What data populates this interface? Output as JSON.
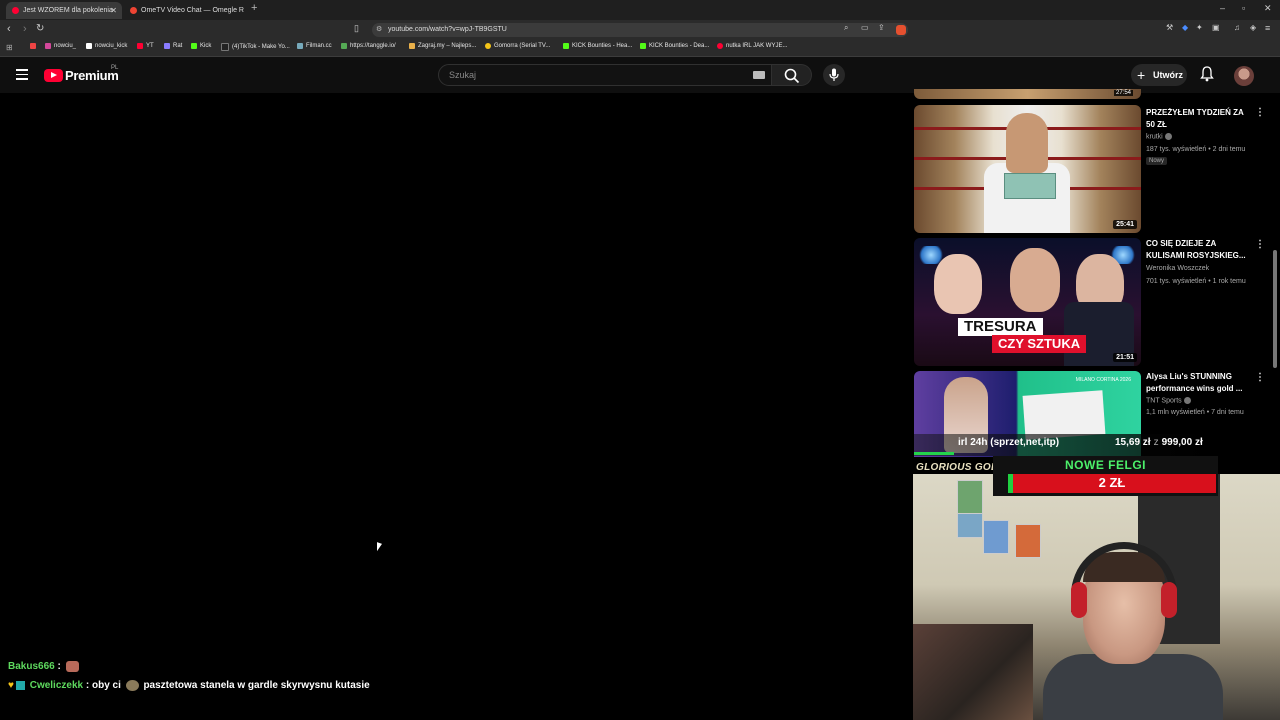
{
  "browser": {
    "tabs": [
      {
        "title": "Jest WZOREM dla pokolenia",
        "active": true
      },
      {
        "title": "OmeTV Video Chat — Omegle R",
        "active": false
      }
    ],
    "new_tab": "+",
    "window_controls": [
      "–",
      "▫",
      "✕"
    ],
    "url": "youtube.com/watch?v=wpJ-TB9GSTU",
    "bookmarks": [
      "nowciu_",
      "nowciu_kick",
      "YT",
      "Rat",
      "Kick",
      "(4)TikTok - Make Yo...",
      "Filman.cc",
      "https://tanggle.io/",
      "Zagraj.my – Najleps...",
      "Gomorra (Serial TV...",
      "KICK Bounties - Hea...",
      "KICK Bounties - Dea...",
      "nutka IRL JAK WYJE..."
    ]
  },
  "youtube": {
    "logo_text": "Premium",
    "logo_region": "PL",
    "search_placeholder": "Szukaj",
    "create_label": "Utwórz"
  },
  "sidebar": {
    "prev_duration": "27:54",
    "videos": [
      {
        "title": "PRZEŻYŁEM TYDZIEŃ ZA 50 ZŁ",
        "channel": "krutki",
        "meta": "187 tys. wyświetleń • 2 dni temu",
        "badge": "Nowy",
        "duration": "25:41"
      },
      {
        "title": "CO SIĘ DZIEJE ZA KULISAMI ROSYJSKIEG...",
        "channel": "Weronika Woszczek",
        "meta": "701 tys. wyświetleń • 1 rok temu",
        "duration": "21:51",
        "thumb_text_1": "TRESURA",
        "thumb_text_2": "CZY SZTUKA"
      },
      {
        "title": "Alysa Liu's STUNNING performance wins gold ...",
        "channel": "TNT Sports",
        "meta": "1,1 mln wyświetleń • 7 dni temu",
        "thumb_text": "MILANO CORTINA 2026"
      }
    ]
  },
  "overlay": {
    "goal_label": "irl 24h (sprzet,net,itp)",
    "goal_current": "15,69 zł",
    "goal_separator": "z",
    "goal_target": "999,00 zł",
    "sponsor": "GLORIOUS GOLD",
    "felgi_title": "NOWE FELGI",
    "felgi_amount": "2 ZŁ"
  },
  "chat": [
    {
      "user": "Bakus666",
      "message": ""
    },
    {
      "user": "Cweliczekk",
      "message": "oby ci",
      "message2": "pasztetowa stanela w gardle skyrwysnu kutasie"
    }
  ],
  "colors": {
    "youtube_red": "#ff0033",
    "goal_green": "#24d34b",
    "felgi_red": "#d8101c",
    "chat_user": "#5ed95e"
  }
}
